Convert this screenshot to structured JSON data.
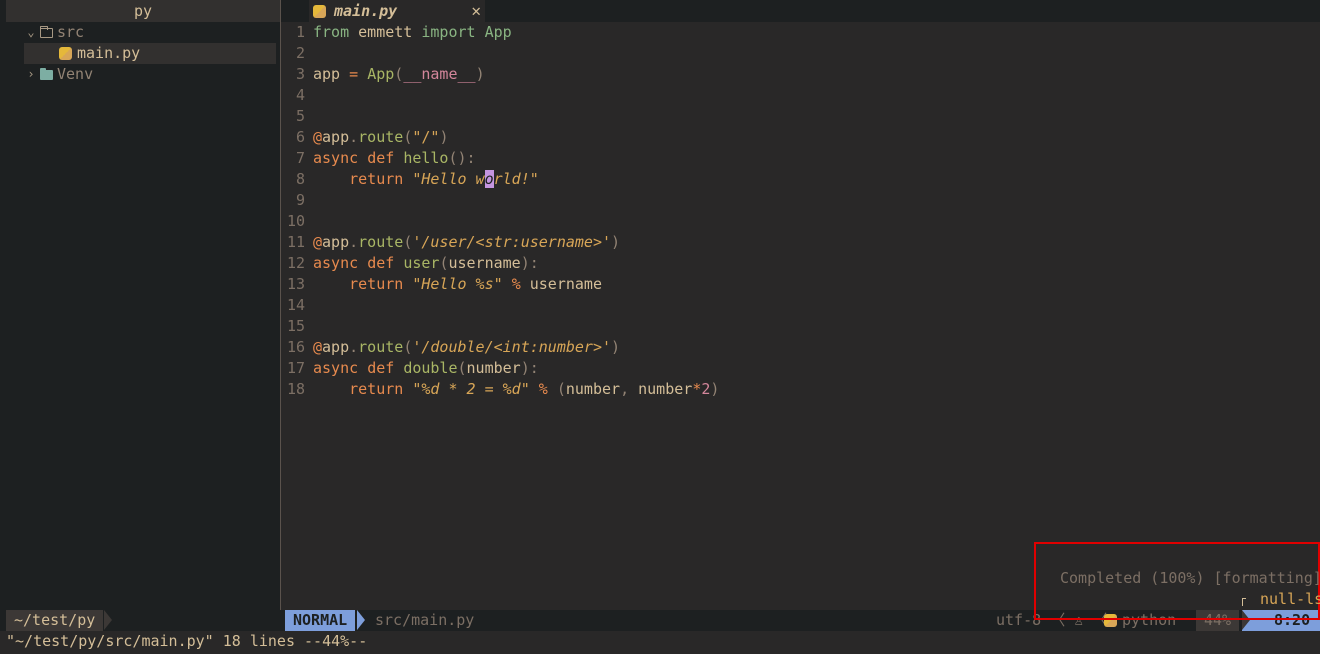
{
  "sidebar": {
    "title": "py",
    "items": [
      {
        "label": "src",
        "chevron": "chevron-down-icon",
        "icon": "folder-open-icon"
      },
      {
        "label": "main.py",
        "icon": "python-file-icon"
      },
      {
        "label": "Venv",
        "chevron": "chevron-right-icon",
        "icon": "folder-icon"
      }
    ]
  },
  "tab": {
    "label": "main.py",
    "close": "✕"
  },
  "editor": {
    "line_numbers": [
      "1",
      "2",
      "3",
      "4",
      "5",
      "6",
      "7",
      "8",
      "9",
      "10",
      "11",
      "12",
      "13",
      "14",
      "15",
      "16",
      "17",
      "18"
    ]
  },
  "status": {
    "cwd": "~/test/py",
    "mode": "NORMAL",
    "file": "src/main.py",
    "encoding": "utf-8",
    "language": "python",
    "percent": "44%",
    "position": "8:20"
  },
  "cmdline": "\"~/test/py/src/main.py\" 18 lines --44%--",
  "notification": {
    "message": "Completed (100%) [formatting]",
    "source": "null-ls"
  },
  "colors": {
    "background": "#292828",
    "sidebar": "#1d2021",
    "mode_accent": "#7d9edb",
    "highlight_border": "#e00000"
  }
}
